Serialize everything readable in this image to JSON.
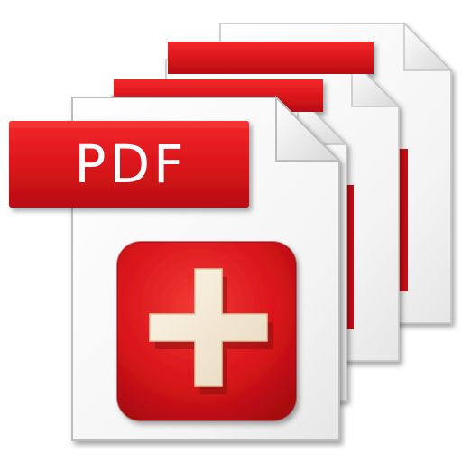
{
  "icon": {
    "name": "add-pdf-icon",
    "label": "PDF",
    "colors": {
      "brand_red": "#e0161b",
      "brand_red_dark": "#a60d10",
      "page_white": "#ffffff",
      "page_edge": "#c9c9c9",
      "plus_fill": "#f6ecd8"
    }
  }
}
